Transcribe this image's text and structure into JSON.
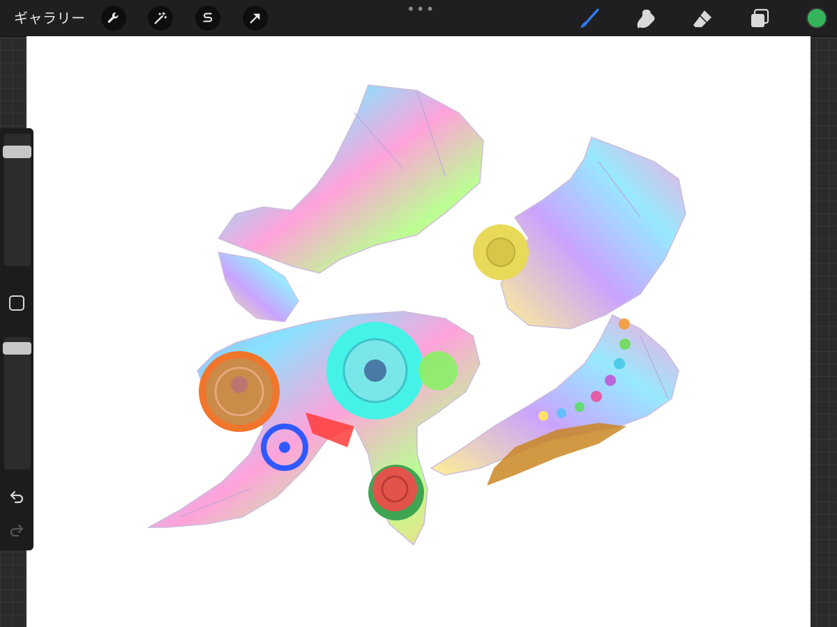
{
  "topbar": {
    "gallery_label": "ギャラリー",
    "actions": [
      {
        "name": "wrench-icon"
      },
      {
        "name": "magic-wand-icon"
      },
      {
        "name": "selection-s-icon"
      },
      {
        "name": "transform-arrow-icon"
      }
    ],
    "more_menu": "•••",
    "tools": [
      {
        "name": "brush-icon",
        "active": true
      },
      {
        "name": "smudge-icon",
        "active": false
      },
      {
        "name": "eraser-icon",
        "active": false
      },
      {
        "name": "layers-icon",
        "active": false
      }
    ],
    "current_color": "#35b45c"
  },
  "sidebar": {
    "brush_size_slider": {
      "level": 0.9
    },
    "opacity_slider": {
      "level": 0.96
    },
    "modify_button_icon": "square-icon",
    "undo_icon": "undo-icon",
    "redo_icon": "redo-icon",
    "redo_enabled": false
  },
  "colors": {
    "accent_blue": "#2d7cf6",
    "ui_dark": "#1f1f21",
    "canvas_bg": "#ffffff"
  }
}
